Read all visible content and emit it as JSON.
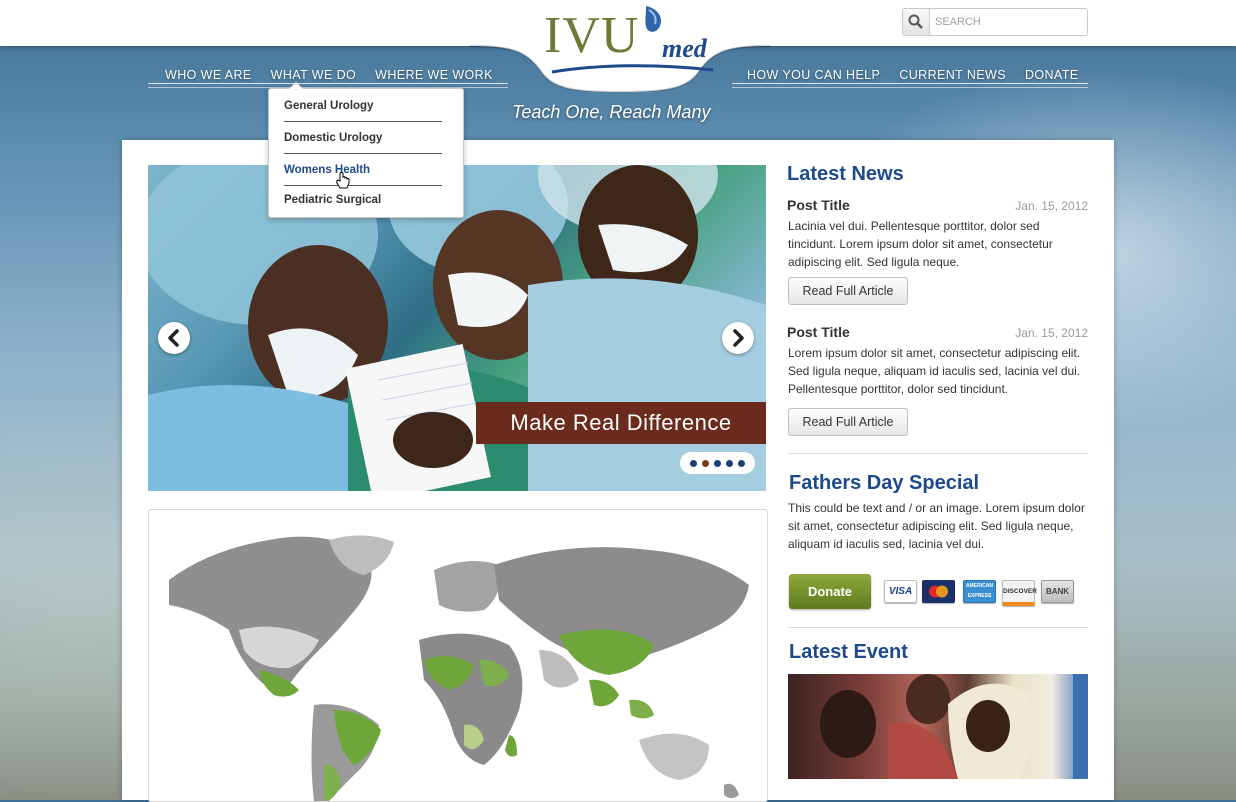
{
  "brand": {
    "logo_main": "IVU",
    "logo_sub": "med",
    "tagline": "Teach One, Reach Many"
  },
  "search": {
    "placeholder": "SEARCH"
  },
  "nav": {
    "left": [
      "WHO WE ARE",
      "WHAT WE DO",
      "WHERE WE WORK"
    ],
    "right": [
      "HOW YOU CAN HELP",
      "CURRENT NEWS",
      "DONATE"
    ]
  },
  "dropdown": {
    "items": [
      "General Urology",
      "Domestic Urology",
      "Womens Health",
      "Pediatric Surgical"
    ],
    "active_index": 2
  },
  "slider": {
    "caption": "Make  Real Difference",
    "dot_count": 5,
    "active_dot": 1
  },
  "news": {
    "heading": "Latest News",
    "posts": [
      {
        "title": "Post Title",
        "date": "Jan. 15, 2012",
        "body": "Lacinia vel dui. Pellentesque porttitor, dolor sed tincidunt. Lorem ipsum dolor sit amet, consectetur adipiscing elit. Sed ligula neque.",
        "button": "Read Full Article"
      },
      {
        "title": "Post Title",
        "date": "Jan. 15, 2012",
        "body": "Lorem ipsum dolor sit amet, consectetur adipiscing elit. Sed ligula neque, aliquam id iaculis sed, lacinia vel dui. Pellentesque porttitor, dolor sed tincidunt.",
        "button": "Read Full Article"
      }
    ]
  },
  "special": {
    "heading": "Fathers Day Special",
    "body": "This could be text and / or an image. Lorem ipsum dolor sit amet, consectetur adipiscing elit. Sed ligula neque, aliquam id iaculis sed, lacinia vel dui.",
    "donate_label": "Donate",
    "payment_methods": [
      "VISA",
      "MasterCard",
      "AMERICAN EXPRESS",
      "DISCOVER",
      "BANK"
    ]
  },
  "event": {
    "heading": "Latest Event"
  },
  "colors": {
    "brand_blue": "#1d4a8a",
    "brand_olive": "#6e7a37",
    "caption_bg": "#6a2a1c",
    "map_green": "#6fa63a"
  }
}
